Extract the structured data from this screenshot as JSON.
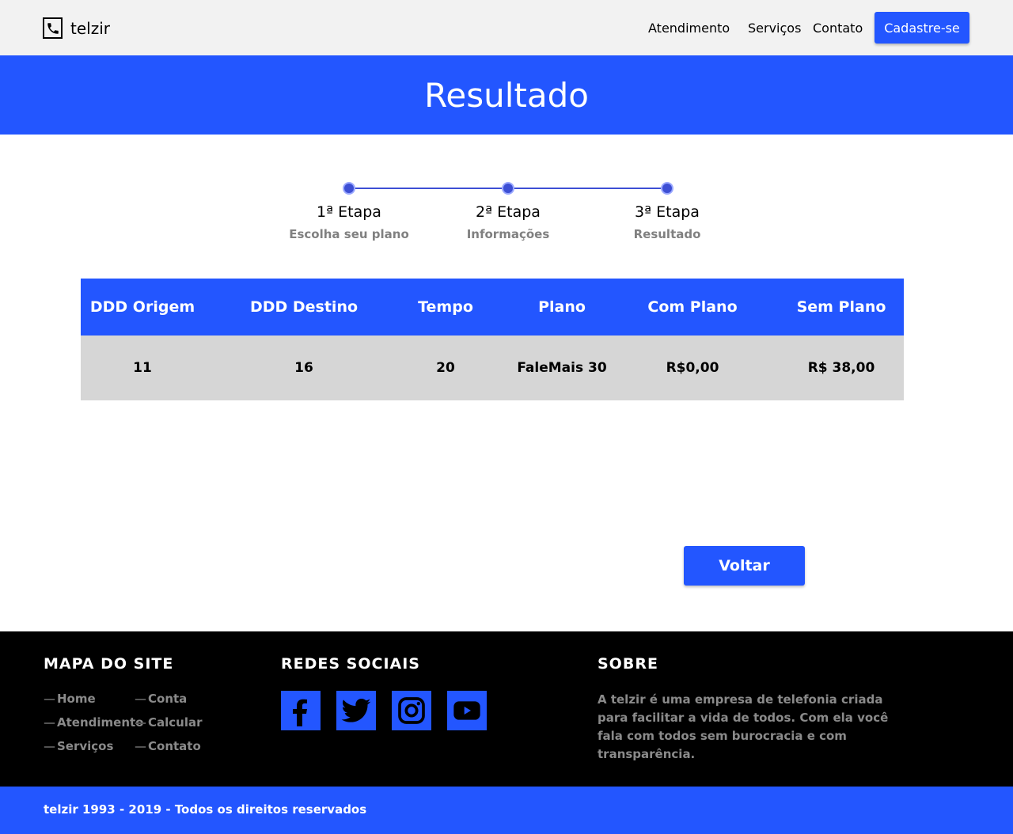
{
  "header": {
    "brand": "telzir",
    "nav": [
      "Atendimento",
      "Serviços",
      "Contato"
    ],
    "cta_label": "Cadastre-se"
  },
  "hero": {
    "title": "Resultado"
  },
  "steps": [
    {
      "title": "1ª Etapa",
      "subtitle": "Escolha seu plano"
    },
    {
      "title": "2ª Etapa",
      "subtitle": "Informações"
    },
    {
      "title": "3ª Etapa",
      "subtitle": "Resultado"
    }
  ],
  "table": {
    "headers": [
      "DDD Origem",
      "DDD Destino",
      "Tempo",
      "Plano",
      "Com Plano",
      "Sem Plano"
    ],
    "rows": [
      [
        "11",
        "16",
        "20",
        "FaleMais 30",
        "R$0,00",
        "R$ 38,00"
      ]
    ]
  },
  "back_label": "Voltar",
  "footer": {
    "sitemap_heading": "MAPA DO SITE",
    "sitemap_links": [
      "Home",
      "Atendimento",
      "Serviços",
      "Conta",
      "Calcular",
      "Contato"
    ],
    "social_heading": "REDES SOCIAIS",
    "social_icons": [
      "facebook-icon",
      "twitter-icon",
      "instagram-icon",
      "youtube-icon"
    ],
    "about_heading": "SOBRE",
    "about_text": "A telzir é uma empresa de telefonia criada para facilitar a vida de todos. Com ela você fala com todos sem burocracia e com transparência.",
    "copyright": "telzir 1993 - 2019 - Todos os direitos reservados"
  },
  "colors": {
    "brand_blue": "#2356ff",
    "footer_bg": "#000000",
    "row_bg": "#d6d6d6"
  }
}
